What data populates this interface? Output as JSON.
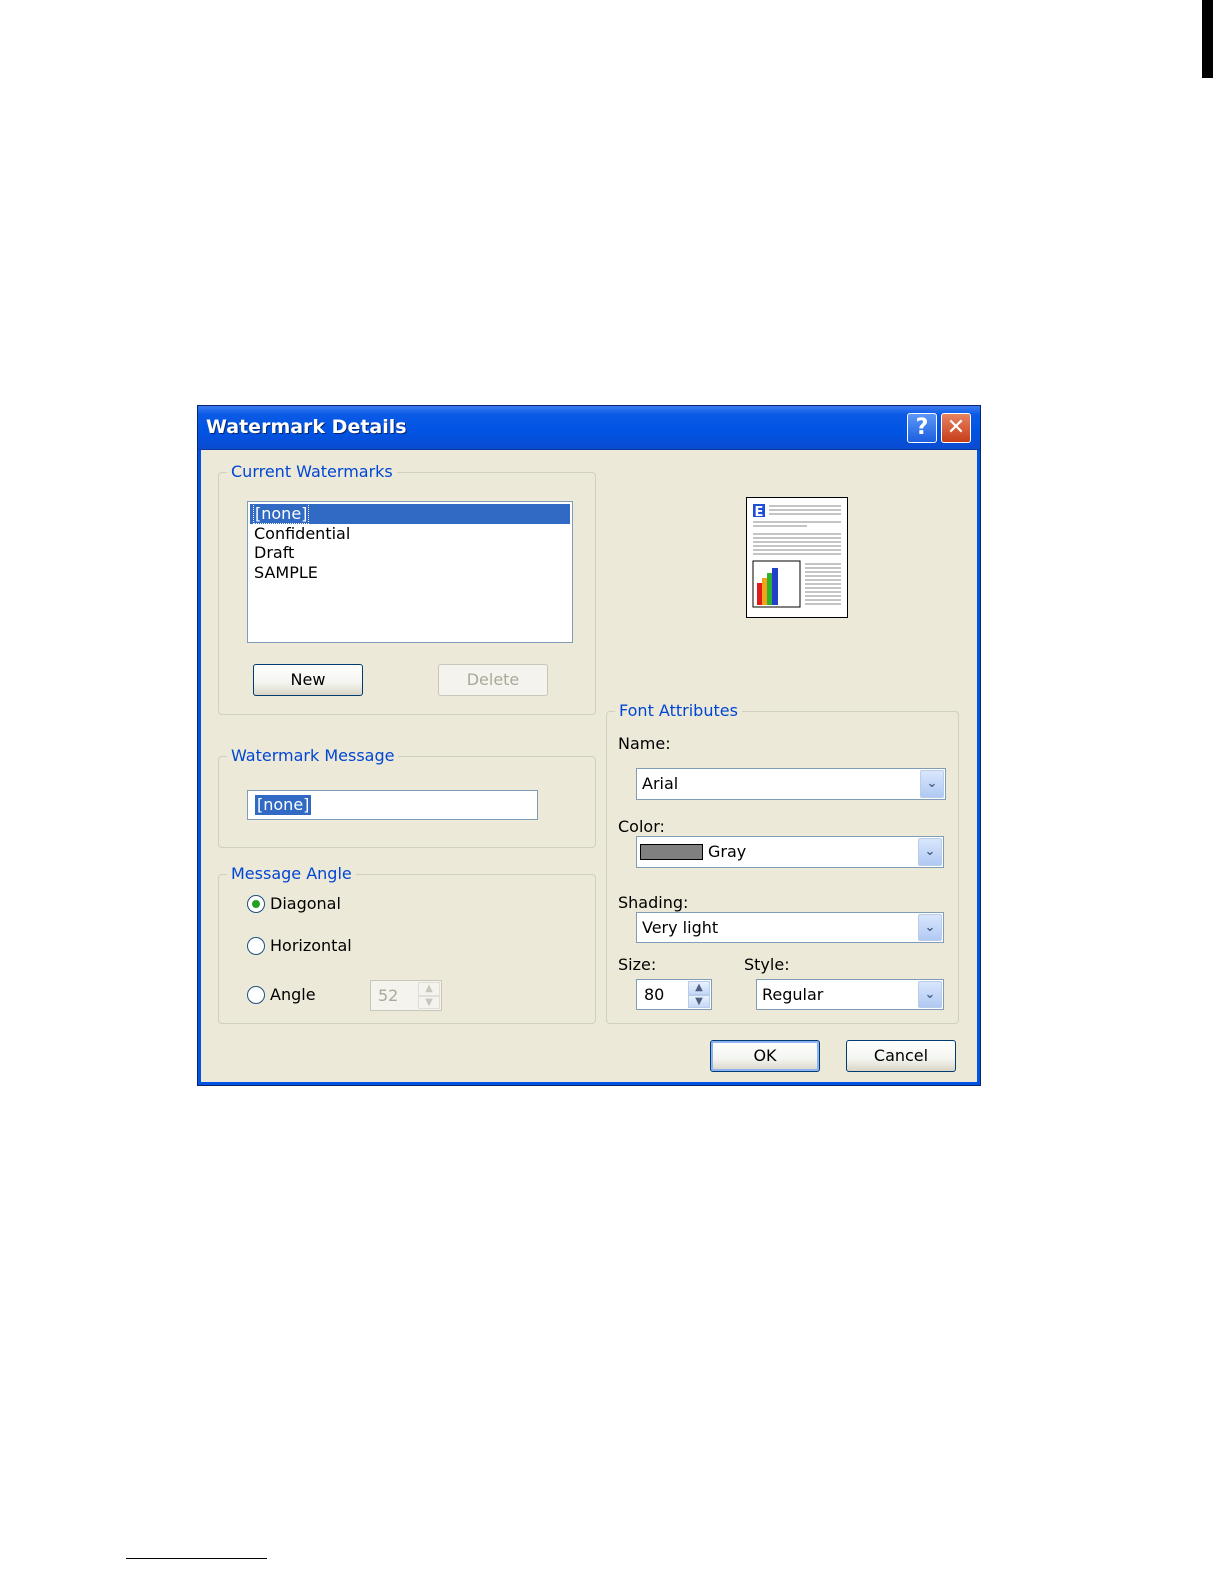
{
  "window": {
    "title": "Watermark Details"
  },
  "title_buttons": {
    "help": "?",
    "close": "✕"
  },
  "current_watermarks": {
    "legend": "Current Watermarks",
    "items": [
      "[none]",
      "Confidential",
      "Draft",
      "SAMPLE"
    ],
    "selected": "[none]",
    "new_label": "New",
    "delete_label": "Delete"
  },
  "watermark_message": {
    "legend": "Watermark Message",
    "value": "[none]"
  },
  "message_angle": {
    "legend": "Message Angle",
    "options": [
      "Diagonal",
      "Horizontal",
      "Angle"
    ],
    "selected": "Diagonal",
    "angle_value": "52"
  },
  "font_attributes": {
    "legend": "Font Attributes",
    "name_label": "Name:",
    "name_value": "Arial",
    "color_label": "Color:",
    "color_value": "Gray",
    "color_swatch": "#808080",
    "shading_label": "Shading:",
    "shading_value": "Very light",
    "size_label": "Size:",
    "size_value": "80",
    "style_label": "Style:",
    "style_value": "Regular"
  },
  "footer": {
    "ok_label": "OK",
    "cancel_label": "Cancel"
  },
  "preview": {
    "icon": "document-preview-icon",
    "letter": "E"
  },
  "colors": {
    "titlebar": "#0054e3",
    "dialog_bg": "#ece9d8",
    "legend_text": "#0046d5",
    "selection": "#316ac5"
  }
}
